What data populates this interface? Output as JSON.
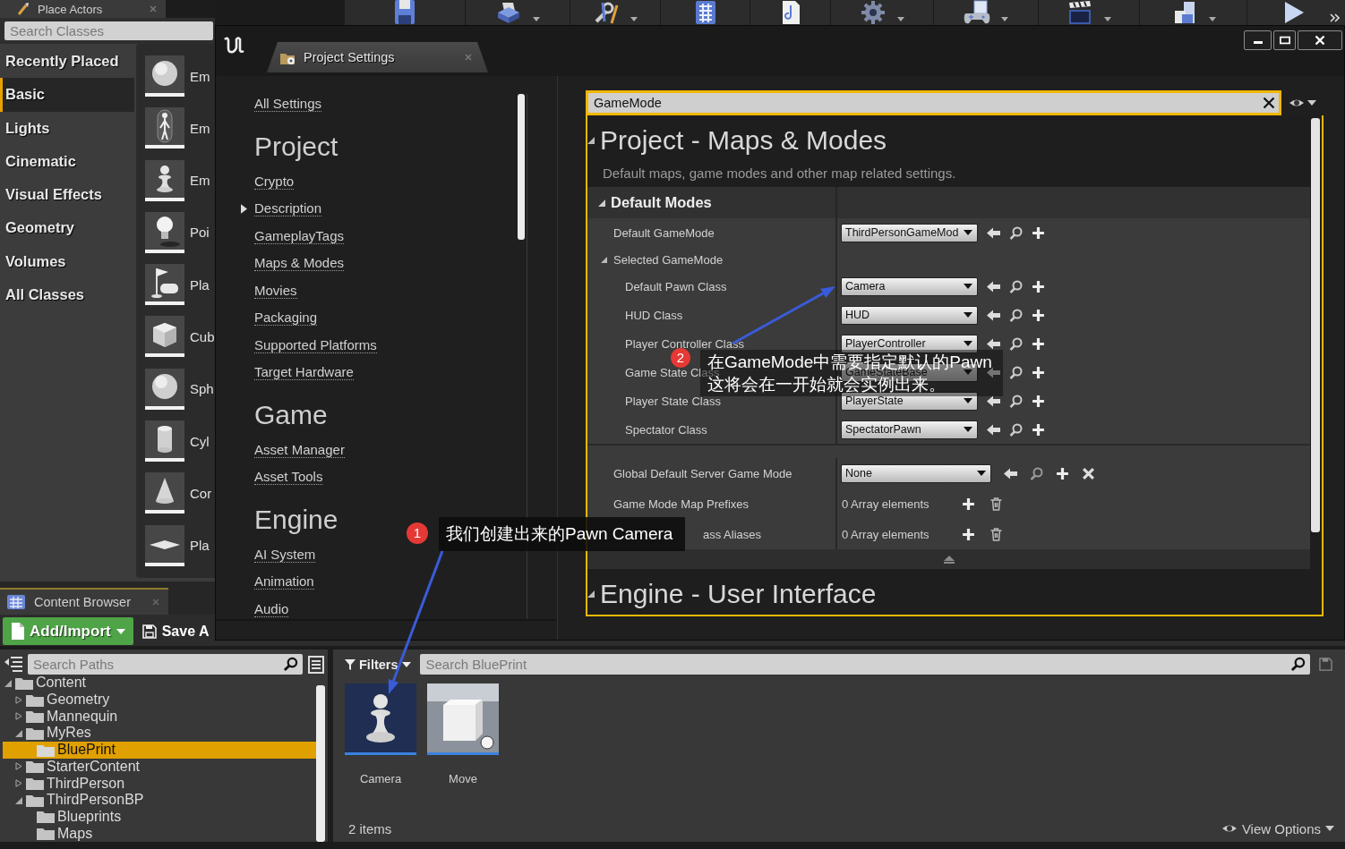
{
  "place_actors": {
    "tab": "Place Actors",
    "search": {
      "placeholder": "Search Classes"
    },
    "categories": [
      {
        "label": "Recently Placed",
        "selected": false
      },
      {
        "label": "Basic",
        "selected": true
      },
      {
        "label": "Lights",
        "selected": false
      },
      {
        "label": "Cinematic",
        "selected": false
      },
      {
        "label": "Visual Effects",
        "selected": false
      },
      {
        "label": "Geometry",
        "selected": false
      },
      {
        "label": "Volumes",
        "selected": false
      },
      {
        "label": "All Classes",
        "selected": false
      }
    ],
    "items": [
      {
        "label": "Em",
        "kind": "sphere"
      },
      {
        "label": "Em",
        "kind": "figure"
      },
      {
        "label": "Em",
        "kind": "pawn"
      },
      {
        "label": "Poi",
        "kind": "bulb"
      },
      {
        "label": "Pla",
        "kind": "flag"
      },
      {
        "label": "Cub",
        "kind": "cube"
      },
      {
        "label": "Sph",
        "kind": "sphere"
      },
      {
        "label": "Cyl",
        "kind": "cylinder"
      },
      {
        "label": "Cor",
        "kind": "cone"
      },
      {
        "label": "Pla",
        "kind": "plane"
      }
    ]
  },
  "settings_window": {
    "tab": "Project Settings",
    "nav": {
      "top_link": "All Settings",
      "sections": [
        {
          "heading": "Project",
          "links": [
            {
              "label": "Crypto"
            },
            {
              "label": "Description",
              "expanded": false
            },
            {
              "label": "GameplayTags"
            },
            {
              "label": "Maps & Modes"
            },
            {
              "label": "Movies"
            },
            {
              "label": "Packaging"
            },
            {
              "label": "Supported Platforms"
            },
            {
              "label": "Target Hardware"
            }
          ]
        },
        {
          "heading": "Game",
          "links": [
            {
              "label": "Asset Manager"
            },
            {
              "label": "Asset Tools"
            }
          ]
        },
        {
          "heading": "Engine",
          "links": [
            {
              "label": "AI System"
            },
            {
              "label": "Animation"
            },
            {
              "label": "Audio"
            }
          ]
        }
      ]
    },
    "search": {
      "value": "GameMode"
    },
    "details": {
      "sections": [
        {
          "title": "Project - Maps & Modes",
          "expanded": true,
          "description": "Default maps, game modes and other map related settings.",
          "categories": [
            {
              "label": "Default Modes",
              "expanded": true,
              "rows": [
                {
                  "label": "Default GameMode",
                  "kind": "class",
                  "value": "ThirdPersonGameMod"
                },
                {
                  "label": "Selected GameMode",
                  "kind": "group",
                  "expanded": true,
                  "children": [
                    {
                      "label": "Default Pawn Class",
                      "kind": "class",
                      "value": "Camera"
                    },
                    {
                      "label": "HUD Class",
                      "kind": "class",
                      "value": "HUD"
                    },
                    {
                      "label": "Player Controller Class",
                      "kind": "class",
                      "value": "PlayerController"
                    },
                    {
                      "label": "Game State Class",
                      "kind": "class",
                      "value": "GameStateBase"
                    },
                    {
                      "label": "Player State Class",
                      "kind": "class",
                      "value": "PlayerState"
                    },
                    {
                      "label": "Spectator Class",
                      "kind": "class",
                      "value": "SpectatorPawn"
                    }
                  ]
                }
              ],
              "advanced": {
                "expanded": true,
                "rows": [
                  {
                    "label": "Global Default Server Game Mode",
                    "kind": "class",
                    "value": "None",
                    "clearable": true
                  },
                  {
                    "label": "Game Mode Map Prefixes",
                    "kind": "array",
                    "value": "0 Array elements"
                  },
                  {
                    "label": "ass Aliases",
                    "kind": "array",
                    "value": "0 Array elements",
                    "partial": true
                  }
                ]
              }
            }
          ]
        },
        {
          "title": "Engine - User Interface",
          "expanded": true
        }
      ]
    }
  },
  "content_browser": {
    "tab": "Content Browser",
    "add_button": "Add/Import",
    "save_button": "Save A",
    "path_search": {
      "placeholder": "Search Paths"
    },
    "tree": [
      {
        "label": "Content",
        "expanded": true,
        "selected": false,
        "children": [
          {
            "label": "Geometry",
            "expanded": false,
            "selected": false
          },
          {
            "label": "Mannequin",
            "expanded": false,
            "selected": false
          },
          {
            "label": "MyRes",
            "expanded": true,
            "selected": false,
            "children": [
              {
                "label": "BluePrint",
                "selected": true
              }
            ]
          },
          {
            "label": "StarterContent",
            "expanded": false,
            "selected": false
          },
          {
            "label": "ThirdPerson",
            "expanded": false,
            "selected": false
          },
          {
            "label": "ThirdPersonBP",
            "expanded": true,
            "selected": false,
            "children": [
              {
                "label": "Blueprints",
                "selected": false
              },
              {
                "label": "Maps",
                "selected": false
              }
            ]
          }
        ]
      }
    ],
    "filters_button": "Filters",
    "asset_search": {
      "placeholder": "Search BluePrint"
    },
    "assets": [
      {
        "label": "Camera",
        "kind": "pawn"
      },
      {
        "label": "Move",
        "kind": "cube"
      }
    ],
    "item_count": "2 items",
    "view_options": "View Options"
  },
  "annotations": [
    {
      "number": "1",
      "text": "我们创建出来的Pawn Camera"
    },
    {
      "number": "2",
      "text": "在GameMode中需要指定默认的Pawn\n这将会在一开始就会实例出来。"
    }
  ]
}
